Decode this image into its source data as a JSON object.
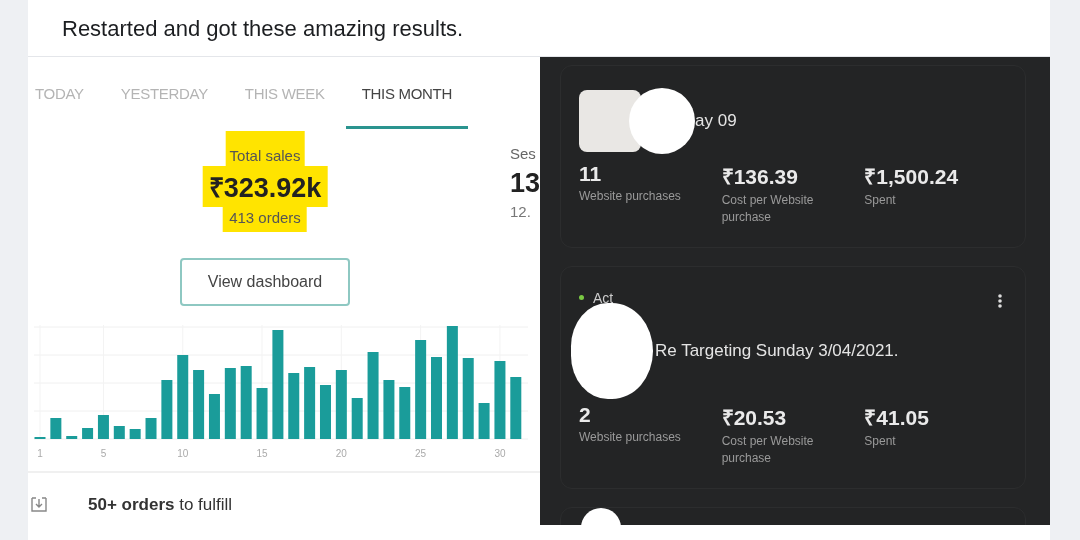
{
  "post": {
    "caption": "Restarted and got these amazing results."
  },
  "store_panel": {
    "tabs": [
      {
        "label": "TODAY",
        "selected": false
      },
      {
        "label": "YESTERDAY",
        "selected": false
      },
      {
        "label": "THIS WEEK",
        "selected": false
      },
      {
        "label": "THIS MONTH",
        "selected": true
      }
    ],
    "stats": [
      {
        "label": "Total sales",
        "value": "₹323.92k",
        "detail": "413 orders",
        "highlighted": true
      },
      {
        "label": "Ses",
        "value": "13",
        "detail": "12.",
        "highlighted": false
      }
    ],
    "dashboard_button": "View dashboard",
    "chart_ticks": [
      "1",
      "5",
      "10",
      "15",
      "20",
      "25",
      "30"
    ],
    "task": "**50+ orders** to fulfill"
  },
  "ads_panel": {
    "campaigns": [
      {
        "title": "ay 09",
        "thumbnail": true,
        "menu": false,
        "metrics": [
          {
            "value": "11",
            "label": "Website purchases"
          },
          {
            "value": "₹136.39",
            "label": "Cost per Website purchase"
          },
          {
            "value": "₹1,500.24",
            "label": "Spent"
          }
        ]
      },
      {
        "title": "Re Targeting Sunday 3/04/2021.",
        "status": "Act",
        "thumbnail": false,
        "menu": true,
        "metrics": [
          {
            "value": "2",
            "label": "Website purchases"
          },
          {
            "value": "₹20.53",
            "label": "Cost per Website purchase"
          },
          {
            "value": "₹41.05",
            "label": "Spent"
          }
        ]
      }
    ]
  }
}
